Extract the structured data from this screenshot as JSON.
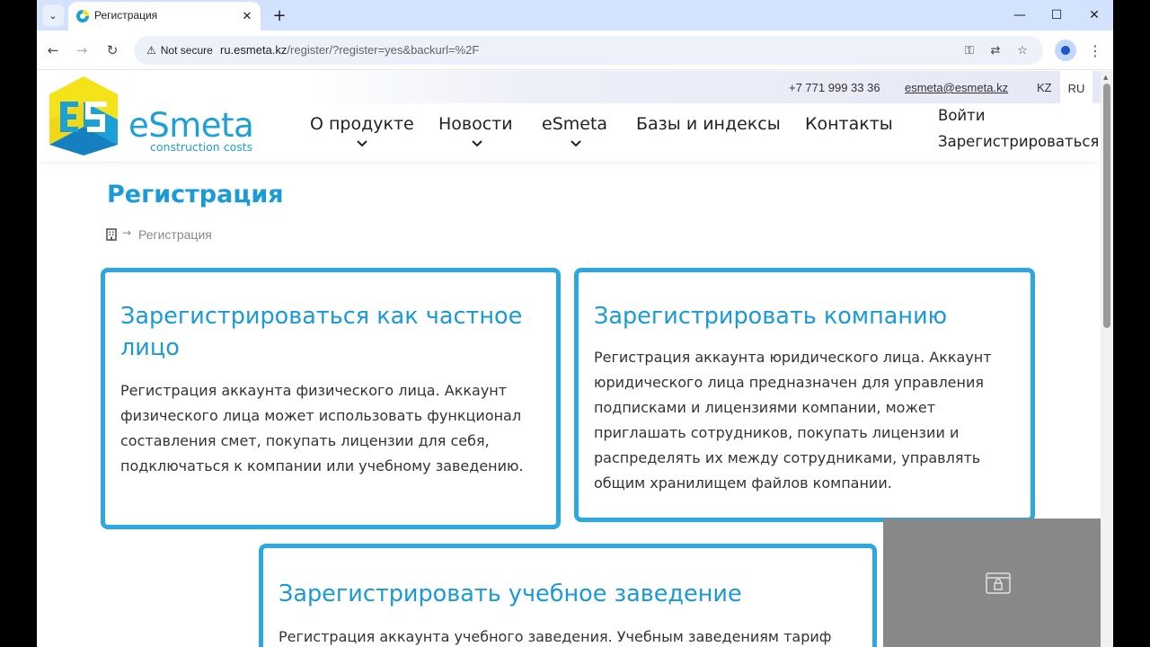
{
  "browser": {
    "tab": {
      "title": "Регистрация",
      "close_glyph": "✕"
    },
    "tab_list_glyph": "⌄",
    "new_tab_glyph": "+",
    "window_controls": {
      "minimize": "—",
      "maximize": "☐",
      "close": "✕"
    },
    "nav": {
      "back": "←",
      "forward": "→",
      "reload": "↻"
    },
    "security_label": "Not secure",
    "url_domain": "ru.esmeta.kz",
    "url_path": "/register/?register=yes&backurl=%2F",
    "omnibox_icons": {
      "key": "⚿",
      "translate": "⇄",
      "bookmark": "☆"
    },
    "menu_glyph": "⋮"
  },
  "site": {
    "logo": {
      "name": "eSmeta",
      "tagline": "construction costs"
    },
    "contacts": {
      "phone": "+7 771 999 33 36",
      "email": "esmeta@esmeta.kz"
    },
    "languages": [
      {
        "code": "KZ",
        "active": false
      },
      {
        "code": "RU",
        "active": true
      }
    ],
    "nav": [
      {
        "label": "О продукте",
        "has_dropdown": true
      },
      {
        "label": "Новости",
        "has_dropdown": true
      },
      {
        "label": "eSmeta",
        "has_dropdown": true
      },
      {
        "label": "Базы и индексы",
        "has_dropdown": false
      },
      {
        "label": "Контакты",
        "has_dropdown": false
      }
    ],
    "auth": {
      "login": "Войти",
      "register": "Зарегистрироваться"
    }
  },
  "main": {
    "title": "Регистрация",
    "breadcrumb": {
      "separator": "→",
      "current": "Регистрация"
    },
    "cards": [
      {
        "title": "Зарегистрироваться как частное лицо",
        "text": "Регистрация аккаунта физического лица. Аккаунт физического лица может использовать функционал составления смет, покупать лицензии для себя, подключаться к компании или учебному заведению."
      },
      {
        "title": "Зарегистрировать компанию",
        "text": "Регистрация аккаунта юридического лица. Аккаунт юридического лица предназначен для управления подписками и лицензиями компании, может приглашать сотрудников, покупать лицензии и распределять их между сотрудниками, управлять общим хранилищем файлов компании."
      },
      {
        "title": "Зарегистрировать учебное заведение",
        "text": "Регистрация аккаунта учебного заведения. Учебным заведениям тариф"
      }
    ]
  },
  "colors": {
    "brand_blue": "#1a9ad6",
    "card_border": "#2aa8df",
    "logo_yellow": "#f5e31a",
    "tab_strip": "#d3e3fd"
  }
}
